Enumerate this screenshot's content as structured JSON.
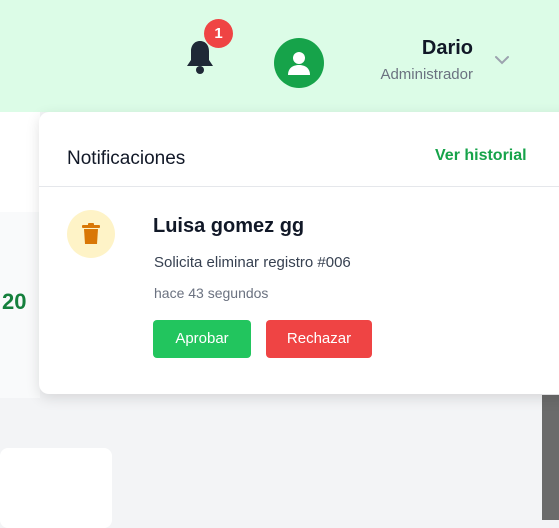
{
  "header": {
    "notification_count": "1",
    "user": {
      "name": "Dario",
      "role": "Administrador"
    }
  },
  "background": {
    "side_number": "20"
  },
  "notifications_panel": {
    "title": "Notificaciones",
    "history_link": "Ver historial",
    "items": [
      {
        "name": "Luisa gomez gg",
        "message": "Solicita eliminar registro #006",
        "time": "hace 43 segundos",
        "icon": "trash-icon",
        "approve_label": "Aprobar",
        "reject_label": "Rechazar"
      }
    ]
  },
  "colors": {
    "header_bg": "#dcfce7",
    "accent_green": "#16a34a",
    "approve": "#22c55e",
    "reject": "#ef4444",
    "badge": "#ef4444"
  }
}
